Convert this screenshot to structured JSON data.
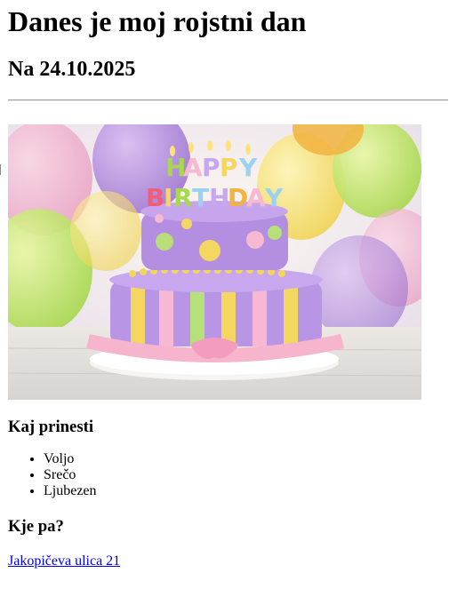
{
  "page": {
    "title": "Danes je moj rojstni dan",
    "date_heading": "Na 24.10.2025"
  },
  "image": {
    "alt": "birthday-cake-photo",
    "cake_topper_text": "HAPPY BIRTHDAY"
  },
  "bring_section": {
    "heading": "Kaj prinesti",
    "items": [
      "Voljo",
      "Srečo",
      "Ljubezen"
    ]
  },
  "location_section": {
    "heading": "Kje pa?",
    "address_link": "Jakopičeva ulica 21"
  },
  "colors": {
    "link": "#0000ee",
    "divider": "#9a9a9a"
  }
}
